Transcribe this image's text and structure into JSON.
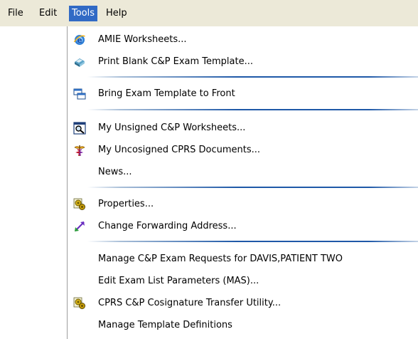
{
  "menubar": {
    "items": [
      {
        "label": "File"
      },
      {
        "label": "Edit"
      },
      {
        "label": "Tools"
      },
      {
        "label": "Help"
      }
    ]
  },
  "tools_menu": {
    "items": [
      {
        "label": "AMIE Worksheets...",
        "icon": "ie-globe-icon"
      },
      {
        "label": "Print Blank C&P Exam Template...",
        "icon": "print-book-icon"
      },
      {
        "label": "Bring Exam Template to Front",
        "icon": "windows-icon"
      },
      {
        "label": "My Unsigned C&P Worksheets...",
        "icon": "magnifier-doc-icon"
      },
      {
        "label": "My Uncosigned CPRS Documents...",
        "icon": "caduceus-icon"
      },
      {
        "label": "News..."
      },
      {
        "label": "Properties...",
        "icon": "gears-icon"
      },
      {
        "label": "Change Forwarding Address...",
        "icon": "double-arrow-icon"
      },
      {
        "label": "Manage C&P Exam Requests for DAVIS,PATIENT TWO"
      },
      {
        "label": "Edit Exam List Parameters (MAS)..."
      },
      {
        "label": "CPRS C&P Cosignature Transfer Utility...",
        "icon": "gears-icon"
      },
      {
        "label": "Manage Template Definitions"
      }
    ]
  }
}
